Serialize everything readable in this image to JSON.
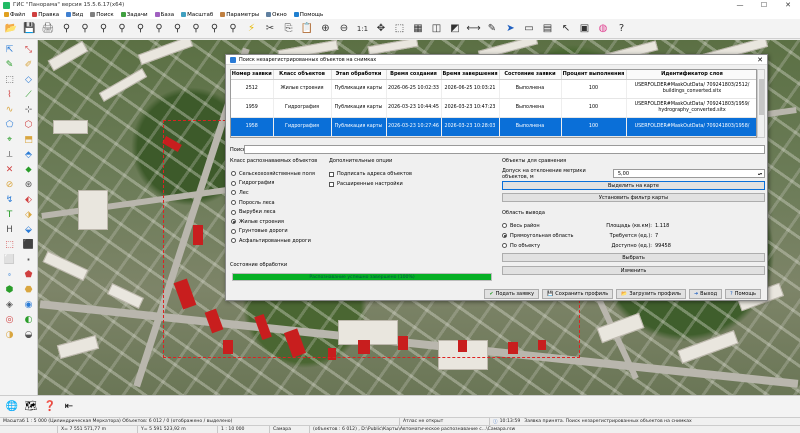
{
  "app": {
    "title": "ГИС \"Панорама\" версия 15.5.6.17(x64)",
    "window_controls": [
      "—",
      "☐",
      "✕"
    ]
  },
  "menu": [
    {
      "label": "Файл",
      "color": "#e0a020"
    },
    {
      "label": "Правка",
      "color": "#d04040"
    },
    {
      "label": "Вид",
      "color": "#4080d0"
    },
    {
      "label": "Поиск",
      "color": "#808080"
    },
    {
      "label": "Задачи",
      "color": "#40a040"
    },
    {
      "label": "База",
      "color": "#a060c0"
    },
    {
      "label": "Масштаб",
      "color": "#40a0c0"
    },
    {
      "label": "Параметры",
      "color": "#c08040"
    },
    {
      "label": "Окно",
      "color": "#6080a0"
    },
    {
      "label": "Помощь",
      "color": "#2080d0"
    }
  ],
  "toolbar_icons": [
    {
      "name": "open-file-icon",
      "glyph": "📂",
      "color": "#d9a640"
    },
    {
      "name": "save-icon",
      "glyph": "💾",
      "color": "#3b6fb5"
    },
    {
      "name": "print-icon",
      "glyph": "🖨",
      "color": "#666"
    },
    {
      "name": "binoculars-icon",
      "glyph": "⚲",
      "color": "#333"
    },
    {
      "name": "binoculars-icon",
      "glyph": "⚲",
      "color": "#333"
    },
    {
      "name": "binoculars-icon",
      "glyph": "⚲",
      "color": "#333"
    },
    {
      "name": "binoculars-icon",
      "glyph": "⚲",
      "color": "#333"
    },
    {
      "name": "binoculars-icon",
      "glyph": "⚲",
      "color": "#333"
    },
    {
      "name": "binoculars-icon",
      "glyph": "⚲",
      "color": "#333"
    },
    {
      "name": "binoculars-icon",
      "glyph": "⚲",
      "color": "#333"
    },
    {
      "name": "binoculars-icon",
      "glyph": "⚲",
      "color": "#333"
    },
    {
      "name": "binoculars-icon",
      "glyph": "⚲",
      "color": "#333"
    },
    {
      "name": "binoculars-icon",
      "glyph": "⚲",
      "color": "#333"
    },
    {
      "name": "lightning-icon",
      "glyph": "⚡",
      "color": "#e6b800"
    },
    {
      "name": "cut-icon",
      "glyph": "✂",
      "color": "#444"
    },
    {
      "name": "copy-icon",
      "glyph": "⎘",
      "color": "#444"
    },
    {
      "name": "clipboard-icon",
      "glyph": "📋",
      "color": "#8a6d3b"
    },
    {
      "name": "zoom-in-icon",
      "glyph": "⊕",
      "color": "#333"
    },
    {
      "name": "zoom-out-icon",
      "glyph": "⊖",
      "color": "#333"
    },
    {
      "name": "zoom-1to1-icon",
      "glyph": "1:1",
      "color": "#333"
    },
    {
      "name": "pan-icon",
      "glyph": "✥",
      "color": "#333"
    },
    {
      "name": "zoom-area-icon",
      "glyph": "⬚",
      "color": "#333"
    },
    {
      "name": "grid-icon",
      "glyph": "▦",
      "color": "#333"
    },
    {
      "name": "layers-icon",
      "glyph": "◫",
      "color": "#333"
    },
    {
      "name": "layers-icon",
      "glyph": "◩",
      "color": "#333"
    },
    {
      "name": "measure-icon",
      "glyph": "⟷",
      "color": "#333"
    },
    {
      "name": "pencil-icon",
      "glyph": "✎",
      "color": "#333"
    },
    {
      "name": "pointer-icon",
      "glyph": "➤",
      "color": "#2060c0"
    },
    {
      "name": "window-icon",
      "glyph": "▭",
      "color": "#333"
    },
    {
      "name": "table-icon",
      "glyph": "▤",
      "color": "#333"
    },
    {
      "name": "cursor-icon",
      "glyph": "↖",
      "color": "#333"
    },
    {
      "name": "image-icon",
      "glyph": "▣",
      "color": "#333"
    },
    {
      "name": "color-wheel-icon",
      "glyph": "◍",
      "color": "#e04090"
    },
    {
      "name": "help-icon",
      "glyph": "?",
      "color": "#333"
    }
  ],
  "left_tools": [
    "⇱",
    "⤡",
    "✎",
    "✐",
    "⬚",
    "◇",
    "⌇",
    "⟋",
    "∿",
    "⊹",
    "⬠",
    "⬡",
    "⌖",
    "⬒",
    "⟂",
    "⬘",
    "✕",
    "⬥",
    "⊘",
    "⊛",
    "↯",
    "⬖",
    "T",
    "⬗",
    "H",
    "⬙",
    "⬚",
    "⬛",
    "⬜",
    "⬝",
    "⬞",
    "⬟",
    "⬢",
    "⬣",
    "◈",
    "◉",
    "◎",
    "◐",
    "◑",
    "◒"
  ],
  "dialog": {
    "title": "Поиск незарегистрированных объектов на снимках",
    "close": "✕",
    "table": {
      "columns": [
        "Номер заявки",
        "Класс объектов",
        "Этап обработки",
        "Время создания",
        "Время завершения",
        "Состояние заявки",
        "Процент выполнения",
        "Идентификатор слоя"
      ],
      "rows": [
        [
          "2512",
          "Жилые строения",
          "Публикация карты",
          "2026-06-25 10:02:33",
          "2026-06-25 10:03:21",
          "Выполнена",
          "100",
          "USERFOLDER#MaskOutData/ 709241803/2512/ buildings_converted.sitx"
        ],
        [
          "1959",
          "Гидрография",
          "Публикация карты",
          "2026-03-23 10:44:45",
          "2026-03-23 10:47:23",
          "Выполнена",
          "100",
          "USERFOLDER#MaskOutData/ 709241803/1959/ hydrography_converted.sitx"
        ],
        [
          "1958",
          "Гидрография",
          "Публикация карты",
          "2026-03-23 10:27:46",
          "2026-03-23 10:28:03",
          "Выполнена",
          "100",
          "USERFOLDER#MaskOutData/ 709241803/1958/"
        ]
      ],
      "selected_row": 2
    },
    "search_label": "Поиск",
    "search_value": "",
    "classes_title": "Класс распознаваемых объектов",
    "classes": [
      {
        "label": "Сельскохозяйственные поля",
        "on": false
      },
      {
        "label": "Гидрография",
        "on": false
      },
      {
        "label": "Лес",
        "on": false
      },
      {
        "label": "Поросль леса",
        "on": false
      },
      {
        "label": "Вырубки леса",
        "on": false
      },
      {
        "label": "Жилые строения",
        "on": true
      },
      {
        "label": "Грунтовые дороги",
        "on": false
      },
      {
        "label": "Асфальтированные дороги",
        "on": false
      }
    ],
    "options_title": "Дополнительные опции",
    "options": [
      {
        "label": "Подписать адреса объектов"
      },
      {
        "label": "Расширенные настройки"
      }
    ],
    "compare_title": "Объекты для сравнения",
    "tolerance_label": "Допуск на отклонение метрики объектов, м",
    "tolerance_value": "5,00",
    "highlight_btn": "Выделить на карте",
    "filter_btn": "Установить фильтр карты",
    "output_title": "Область вывода",
    "output_options": [
      {
        "label": "Весь район",
        "key": "Площадь (кв.км):",
        "value": "1.118",
        "on": false
      },
      {
        "label": "Прямоугольная область",
        "key": "Требуется (ед.):",
        "value": "7",
        "on": true
      },
      {
        "label": "По объекту",
        "key": "Доступно (ед.):",
        "value": "99458",
        "on": false
      }
    ],
    "choose_btn": "Выбрать",
    "change_btn": "Изменить",
    "state_title": "Состояние обработки",
    "progress_text": "Распознавание успешно завершено (100%)",
    "progress_percent": 100,
    "bottom_buttons": [
      {
        "label": "Подать заявку",
        "icon": "✔",
        "color": "#2a9d2a"
      },
      {
        "label": "Сохранить профиль",
        "icon": "💾",
        "color": "#3b6fb5"
      },
      {
        "label": "Загрузить профиль",
        "icon": "📂",
        "color": "#d9a640"
      },
      {
        "label": "Выход",
        "icon": "➜",
        "color": "#2060c0"
      },
      {
        "label": "Помощь",
        "icon": "?",
        "color": "#2060c0"
      }
    ]
  },
  "bottom_tools": [
    {
      "name": "globe-icon",
      "glyph": "🌐"
    },
    {
      "name": "layers-tool-icon",
      "glyph": "🗺"
    },
    {
      "name": "help-icon",
      "glyph": "❓"
    },
    {
      "name": "exit-icon",
      "glyph": "⇤"
    }
  ],
  "status": {
    "line1": {
      "left": "Масштаб 1 : 5 000 (Цилиндрическая Меркатора) Объектов: 6 012 / 0 (отображено / выделено)",
      "atlas": "Атлас не открыт",
      "time": "10:13:59",
      "message": "Заявка принята. Поиск незарегистрированных объектов на снимках"
    },
    "line2": {
      "x": "X= 7 551 571,77 m",
      "y": "Y= 5 591 523,92 m",
      "scale": "1 : 10 000",
      "map": "Самара",
      "info": "(объектов : 6 012) , D:\\Public\\Карты\\Автоматическое распознавание с...\\Самара.rsw"
    }
  }
}
